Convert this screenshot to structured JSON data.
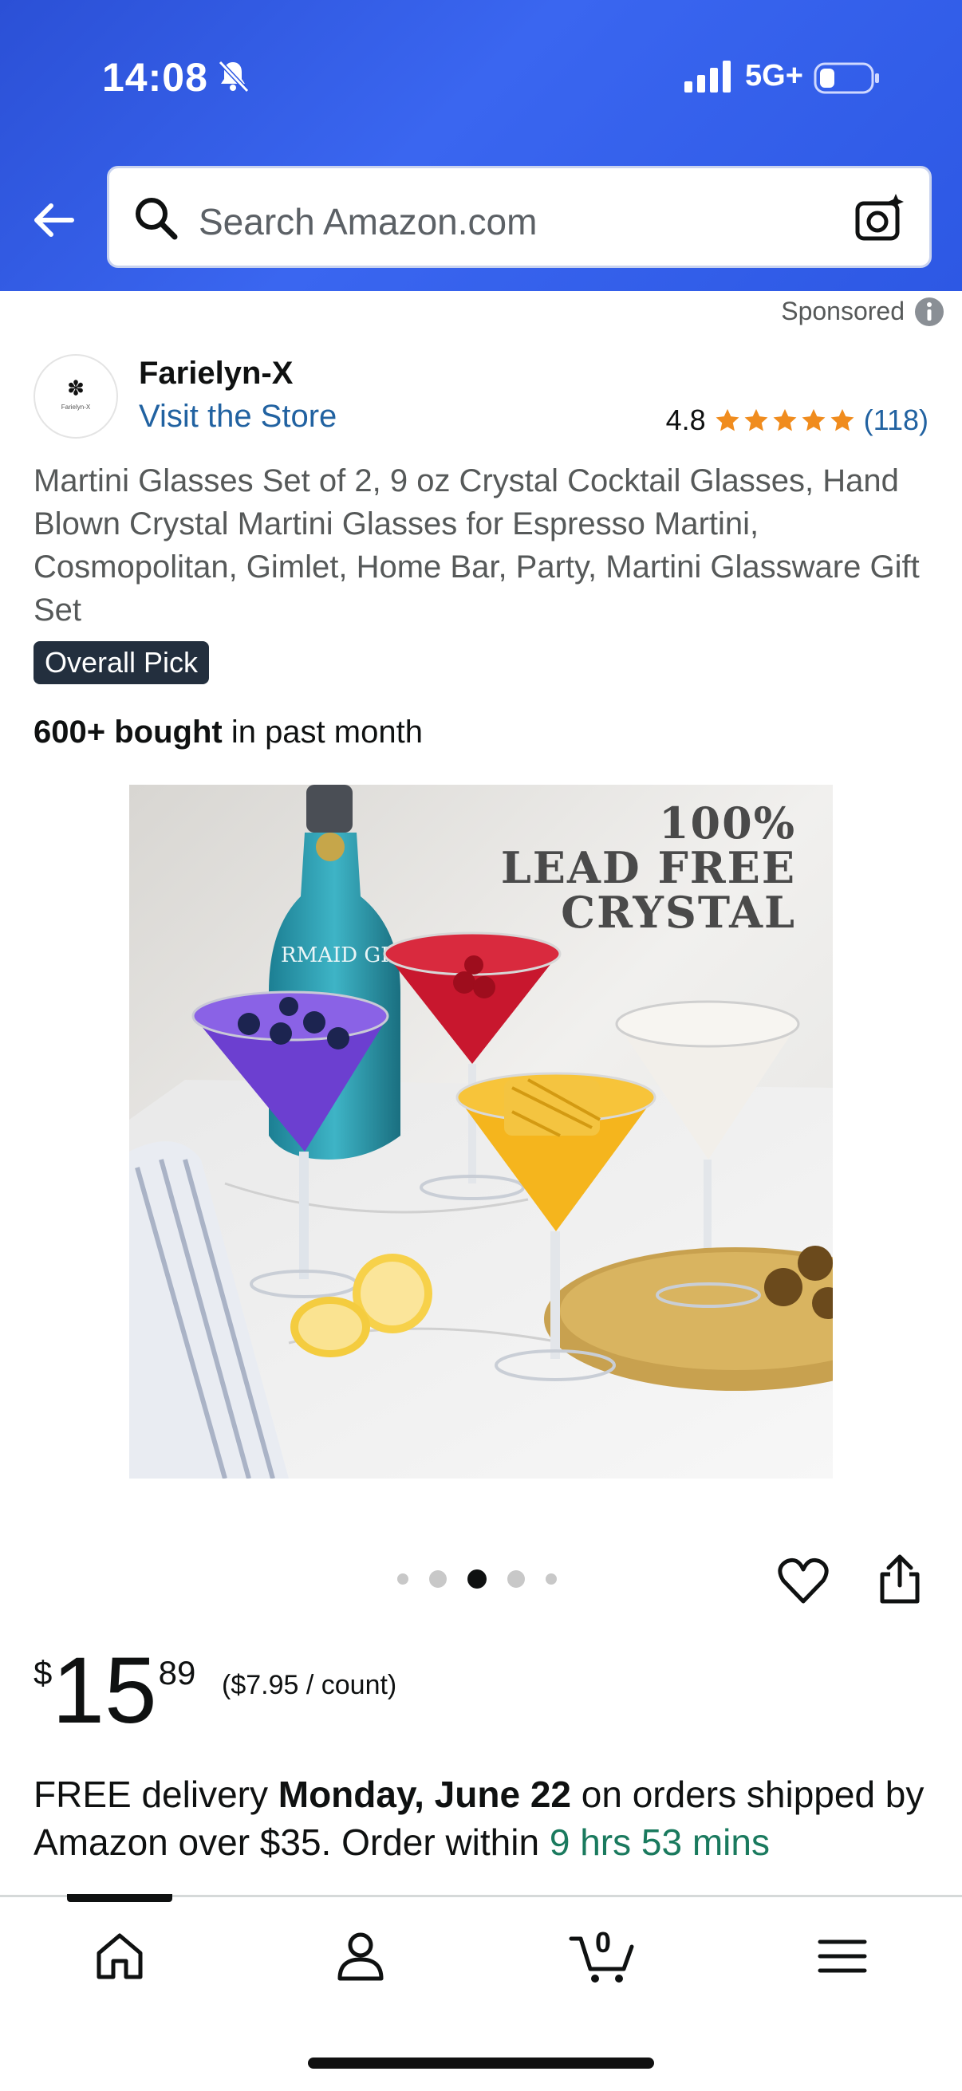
{
  "status_bar": {
    "time": "14:08",
    "network": "5G+"
  },
  "search": {
    "placeholder": "Search Amazon.com"
  },
  "sponsored_label": "Sponsored",
  "store": {
    "name": "Farielyn-X",
    "link_label": "Visit the Store",
    "logo_text": "Farielyn-X"
  },
  "rating": {
    "value": "4.8",
    "stars": 5,
    "count": "(118)"
  },
  "product": {
    "title": "Martini Glasses Set of 2, 9 oz Crystal Cocktail Glasses, Hand Blown Crystal Martini Glasses for Espresso Martini, Cosmopolitan, Gimlet, Home Bar, Party, Martini Glassware Gift Set",
    "badge": "Overall Pick",
    "bought_bold": "600+ bought",
    "bought_rest": " in past month",
    "image_caption": [
      "100%",
      "LEAD FREE",
      "CRYSTAL"
    ],
    "bottle_label": "RMAID GIN"
  },
  "carousel": {
    "count": 5,
    "active_index": 2
  },
  "price": {
    "symbol": "$",
    "whole": "15",
    "fraction": "89",
    "unit_price": "($7.95 / count)"
  },
  "delivery": {
    "prefix": "FREE delivery ",
    "date": "Monday, June 22",
    "middle": " on orders shipped by Amazon over $35. Order within ",
    "countdown": "9 hrs 53 mins"
  },
  "bottom_nav": {
    "cart_count": "0",
    "items": [
      "home",
      "account",
      "cart",
      "menu"
    ]
  },
  "colors": {
    "header": "#2d58e4",
    "link": "#2162a1",
    "star": "#f08c1e",
    "countdown": "#1a7a5e",
    "badge": "#232f3e"
  }
}
